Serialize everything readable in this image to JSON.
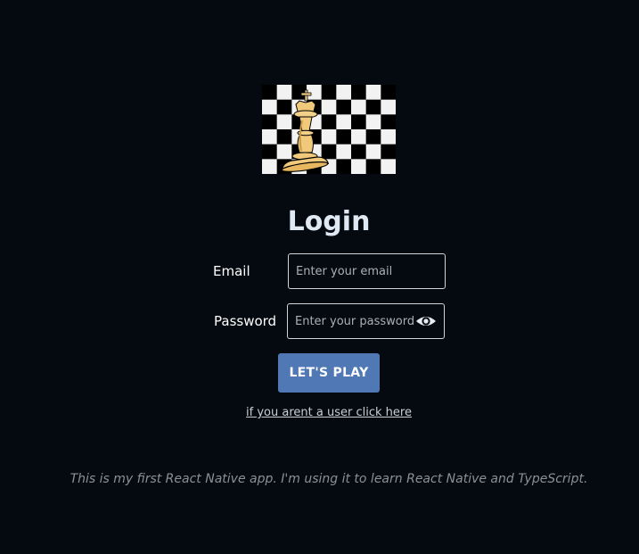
{
  "logo": {
    "icon": "chess-king-checkerboard-logo"
  },
  "login": {
    "title": "Login",
    "email_label": "Email",
    "email_placeholder": "Enter your email",
    "email_value": "",
    "password_label": "Password",
    "password_placeholder": "Enter your password",
    "password_value": "",
    "show_password_icon": "eye-icon",
    "submit_label": "LET'S PLAY",
    "signup_link": "if you arent a user click here"
  },
  "footer": {
    "text": "This is my first React Native app. I'm using it to learn React Native and TypeScript."
  },
  "colors": {
    "background": "#050a11",
    "button": "#4f78b5",
    "title": "#dfe9f3",
    "footer_text": "#8a9099",
    "field_border": "#cfd6de",
    "king_gold": "#f0c97a"
  }
}
